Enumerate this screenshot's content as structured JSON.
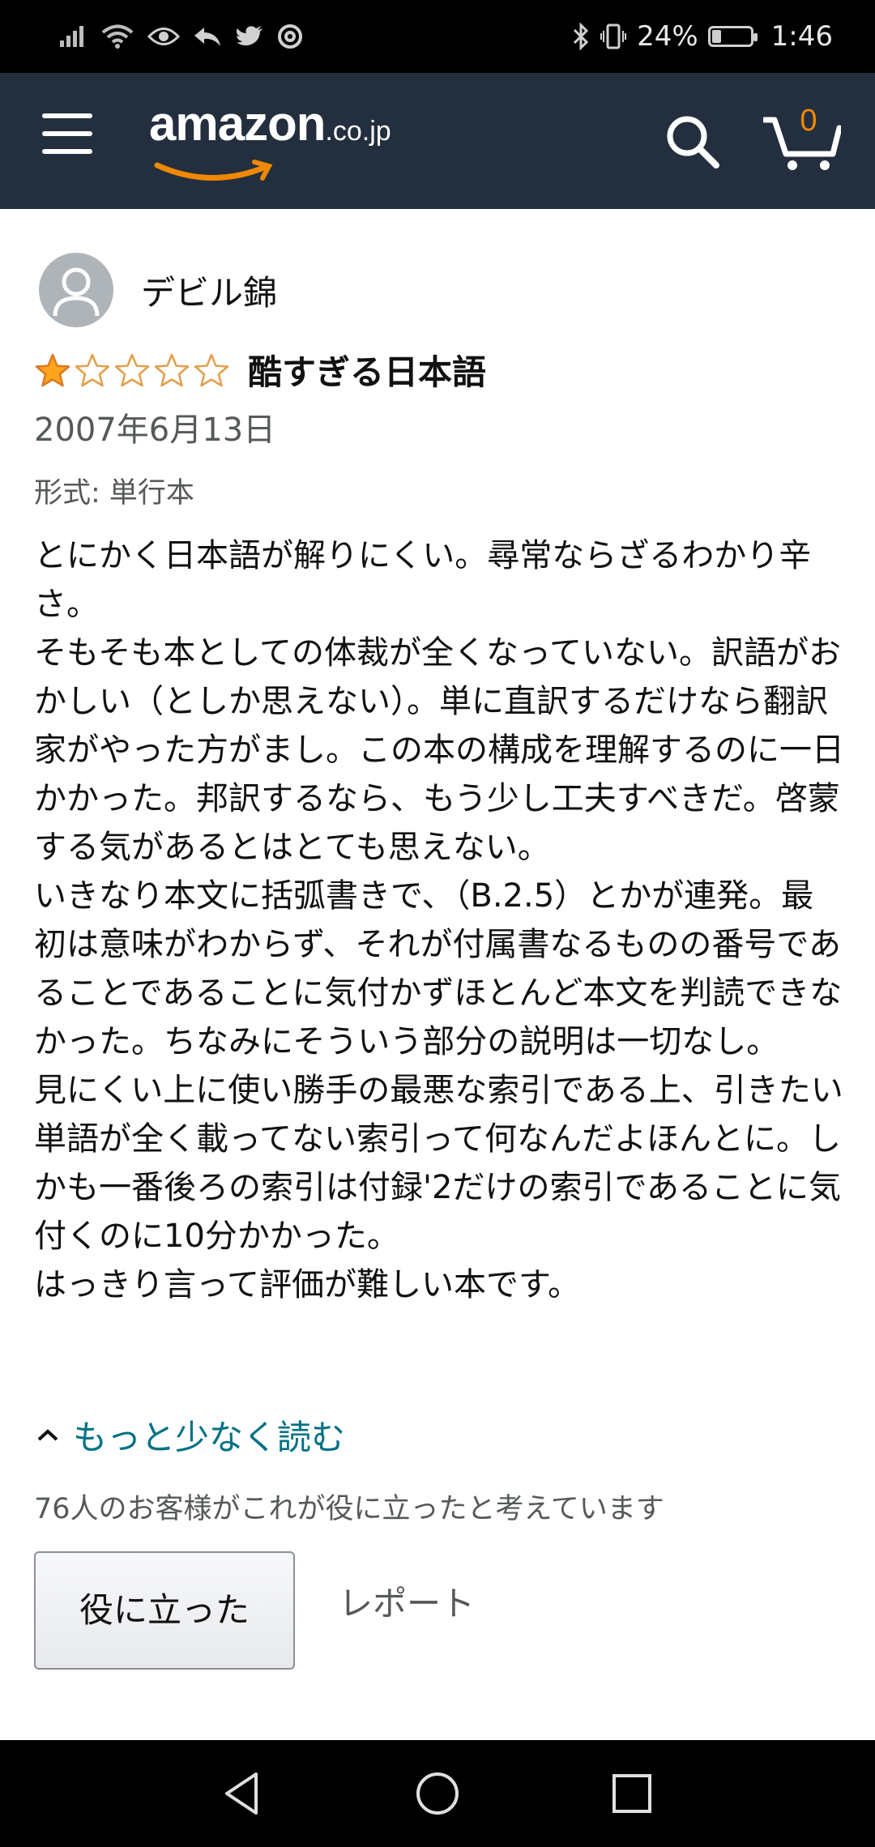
{
  "status_bar": {
    "battery_percent": "24%",
    "battery_level": 0.24,
    "time": "1:46"
  },
  "header": {
    "logo_word": "amazon",
    "logo_tld": ".co.jp",
    "cart_count": "0",
    "icons": [
      "menu-icon",
      "search-icon",
      "cart-icon"
    ],
    "background_color": "#232f3e",
    "accent_color": "#f08804"
  },
  "review": {
    "reviewer_name": "デビル錦",
    "rating": 1,
    "rating_max": 5,
    "title": "酷すぎる日本語",
    "date": "2007年6月13日",
    "format": "形式: 単行本",
    "body": [
      "とにかく日本語が解りにくい。尋常ならざるわかり辛さ。",
      "そもそも本としての体裁が全くなっていない。訳語がおかしい（としか思えない）。単に直訳するだけなら翻訳家がやった方がまし。この本の構成を理解するのに一日かかった。邦訳するなら、もう少し工夫すべきだ。啓蒙する気があるとはとても思えない。",
      "いきなり本文に括弧書きで、（B.2.5）とかが連発。最初は意味がわからず、それが付属書なるものの番号であることであることに気付かずほとんど本文を判読できなかった。ちなみにそういう部分の説明は一切なし。",
      "見にくい上に使い勝手の最悪な索引である上、引きたい単語が全く載ってない索引って何なんだよほんとに。しかも一番後ろの索引は付録'2だけの索引であることに気付くのに10分かかった。",
      "はっきり言って評価が難しい本です。"
    ],
    "read_less": "もっと少なく読む",
    "helpful_count": "76人のお客様がこれが役に立ったと考えています",
    "helpful_button": "役に立った",
    "report_link": "レポート",
    "link_color": "#007185",
    "star_color": "#ffa41c"
  },
  "nav_bar": {
    "icons": [
      "back-icon",
      "home-icon",
      "recents-icon"
    ]
  }
}
